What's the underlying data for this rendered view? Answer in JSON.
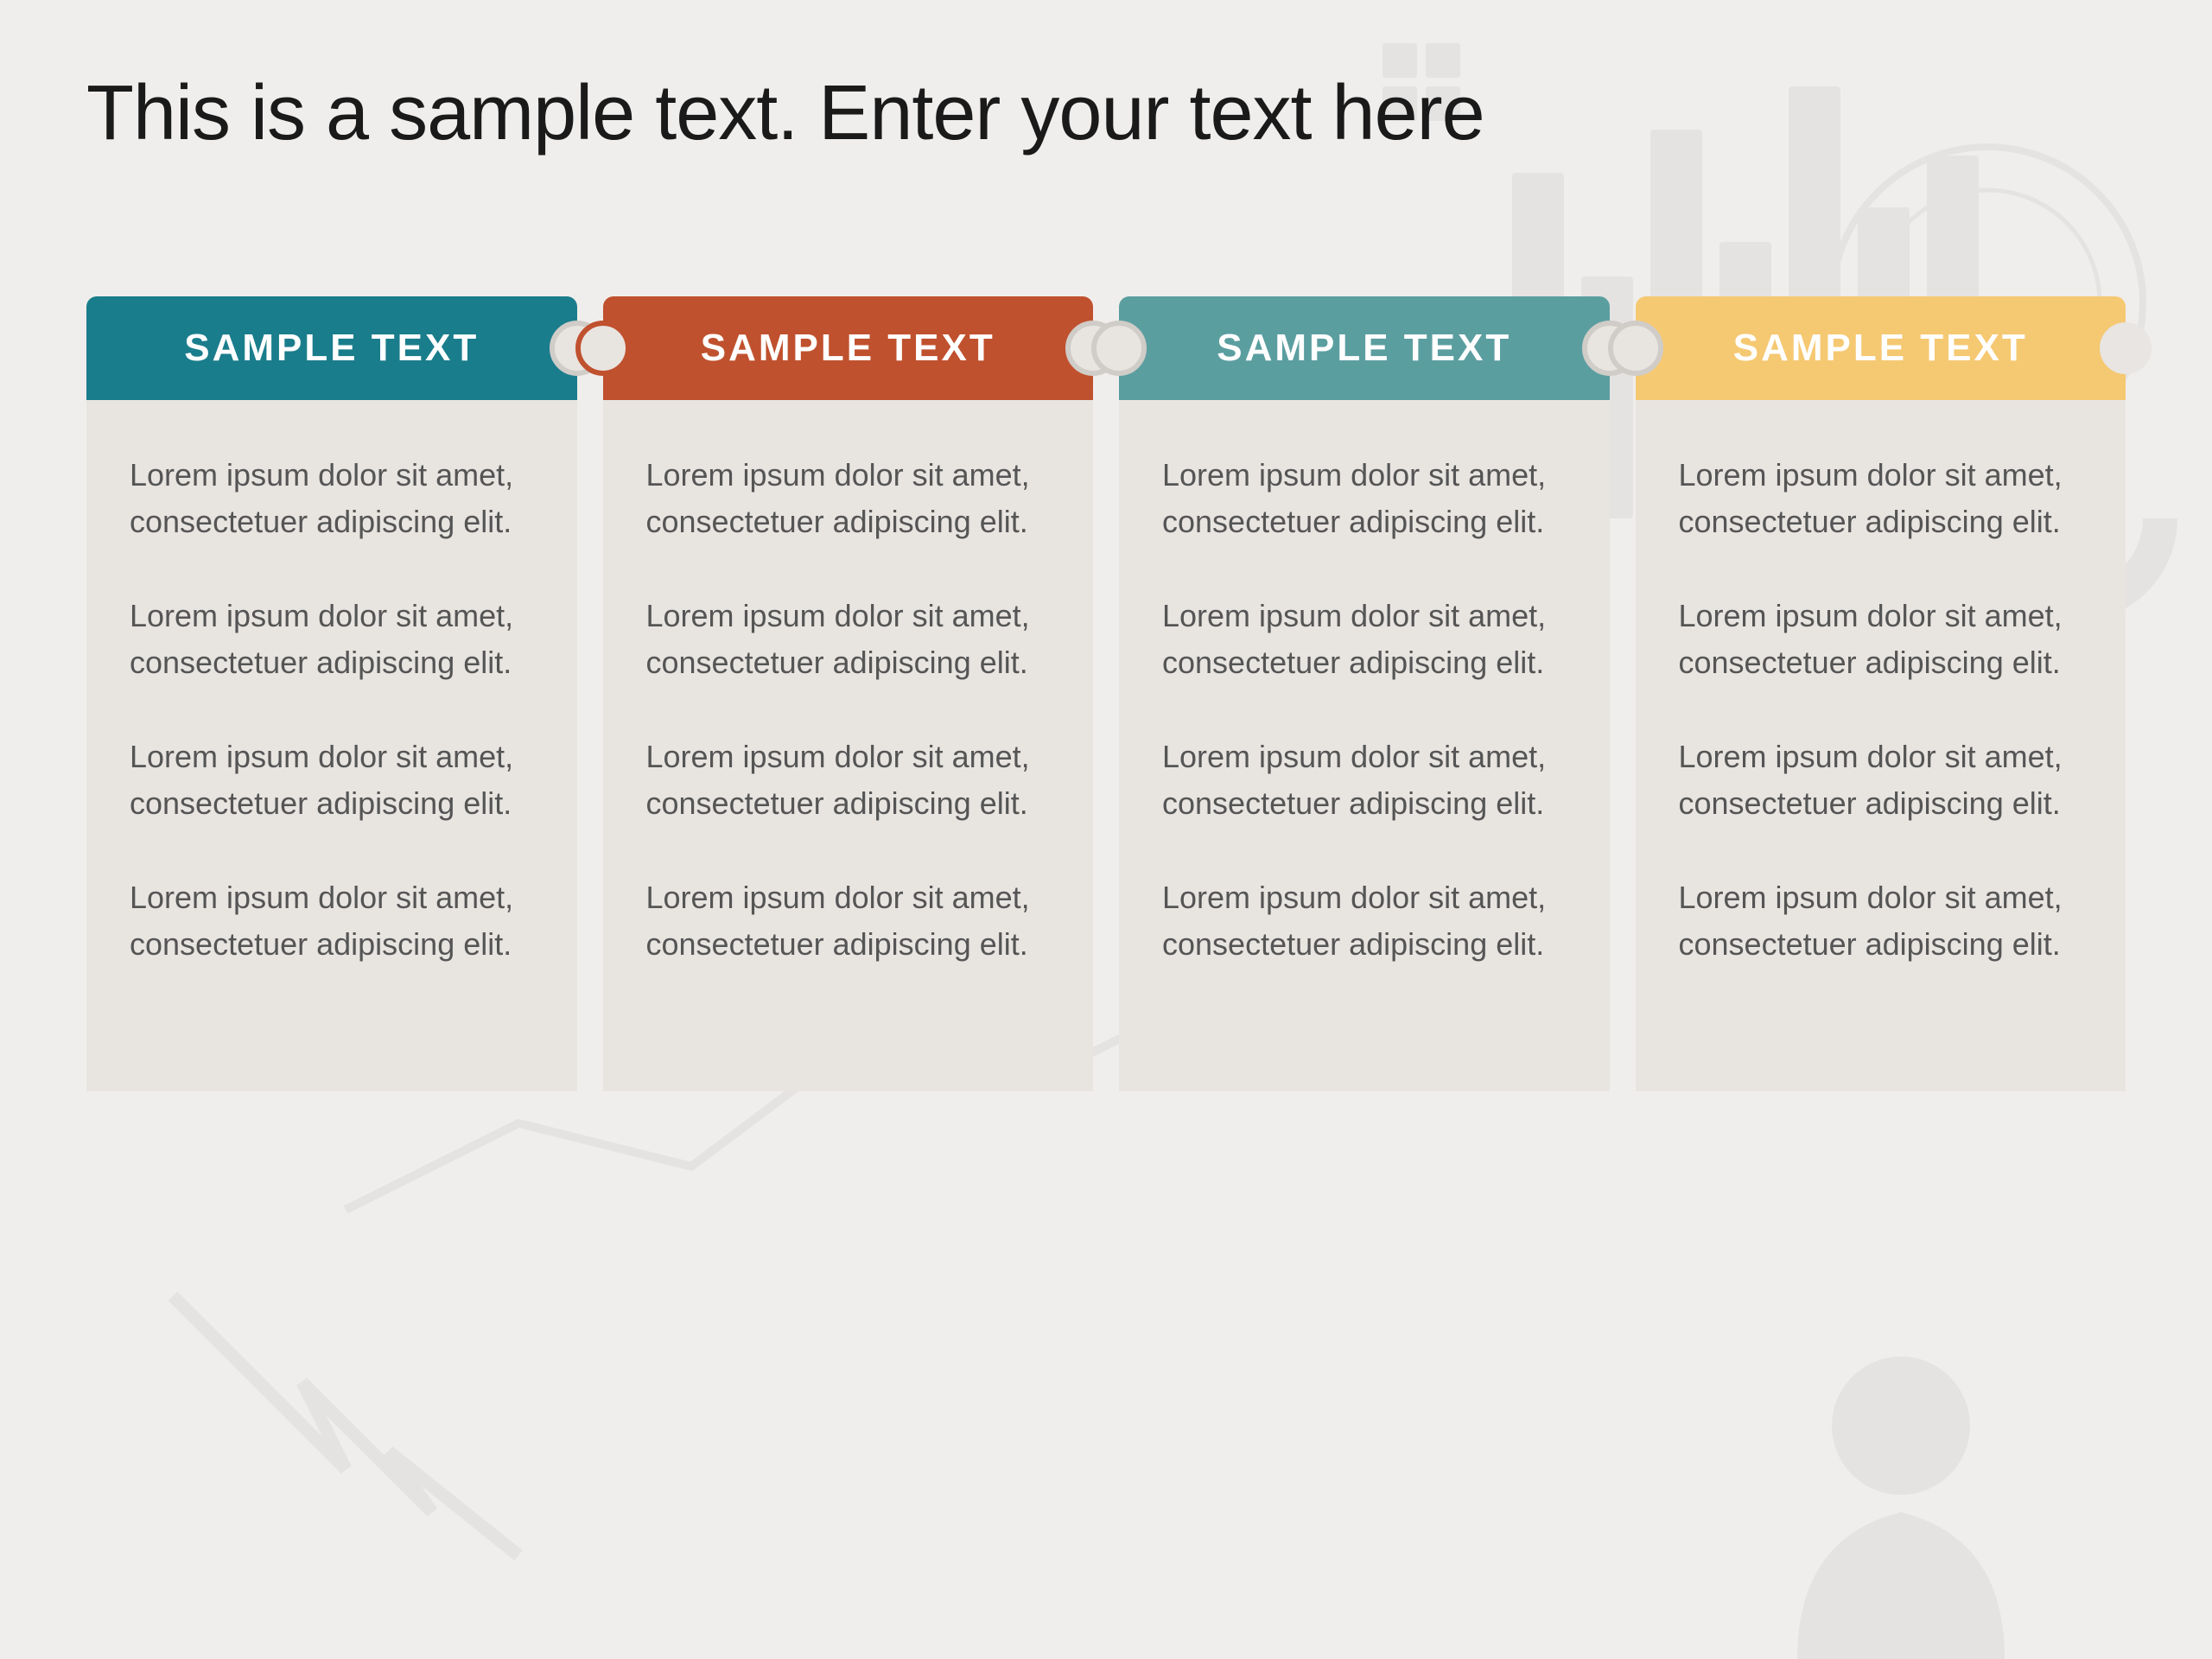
{
  "page": {
    "title": "This is a sample text. Enter your text here",
    "background_color": "#f0eeec"
  },
  "columns": [
    {
      "id": "col-1",
      "header": "SAMPLE TEXT",
      "header_color": "#1a7d8c",
      "paragraphs": [
        "Lorem ipsum dolor sit amet, consectetuer adipiscing elit.",
        "Lorem ipsum dolor sit amet, consectetuer adipiscing elit.",
        "Lorem ipsum dolor sit amet, consectetuer adipiscing elit.",
        "Lorem ipsum dolor sit amet, consectetuer adipiscing elit."
      ]
    },
    {
      "id": "col-2",
      "header": "SAMPLE TEXT",
      "header_color": "#c0512e",
      "paragraphs": [
        "Lorem ipsum dolor sit amet, consectetuer adipiscing elit.",
        "Lorem ipsum dolor sit amet, consectetuer adipiscing elit.",
        "Lorem ipsum dolor sit amet, consectetuer adipiscing elit.",
        "Lorem ipsum dolor sit amet, consectetuer adipiscing elit."
      ]
    },
    {
      "id": "col-3",
      "header": "SAMPLE TEXT",
      "header_color": "#5b9ea0",
      "paragraphs": [
        "Lorem ipsum dolor sit amet, consectetuer adipiscing elit.",
        "Lorem ipsum dolor sit amet, consectetuer adipiscing elit.",
        "Lorem ipsum dolor sit amet, consectetuer adipiscing elit.",
        "Lorem ipsum dolor sit amet, consectetuer adipiscing elit."
      ]
    },
    {
      "id": "col-4",
      "header": "SAMPLE TEXT",
      "header_color": "#f5c872",
      "paragraphs": [
        "Lorem ipsum dolor sit amet, consectetuer adipiscing elit.",
        "Lorem ipsum dolor sit amet, consectetuer adipiscing elit.",
        "Lorem ipsum dolor sit amet, consectetuer adipiscing elit.",
        "Lorem ipsum dolor sit amet, consectetuer adipiscing elit."
      ]
    }
  ],
  "connectors": {
    "colors": [
      "#888888",
      "#c0512e",
      "#888888"
    ]
  }
}
